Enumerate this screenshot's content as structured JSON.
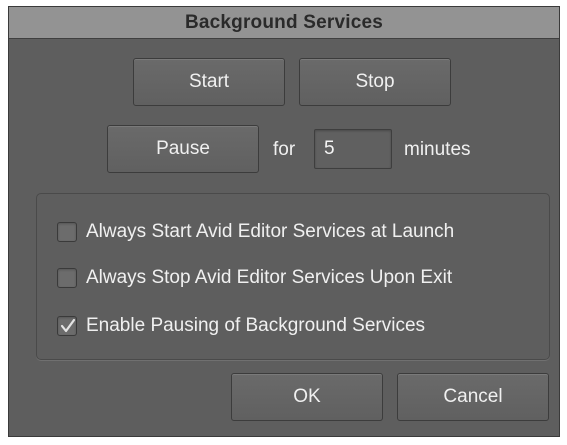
{
  "dialog": {
    "title": "Background Services"
  },
  "buttons": {
    "start": "Start",
    "stop": "Stop",
    "pause": "Pause",
    "ok": "OK",
    "cancel": "Cancel"
  },
  "pause_row": {
    "for_label": "for",
    "minutes_value": "5",
    "minutes_label": "minutes"
  },
  "options": [
    {
      "label": "Always Start Avid Editor Services at Launch",
      "checked": false
    },
    {
      "label": "Always Stop Avid Editor Services Upon Exit",
      "checked": false
    },
    {
      "label": "Enable Pausing of Background Services",
      "checked": true
    }
  ],
  "colors": {
    "dialog_bg": "#5e5e5e",
    "titlebar_bg": "#939393",
    "text": "#f0f0f0"
  }
}
